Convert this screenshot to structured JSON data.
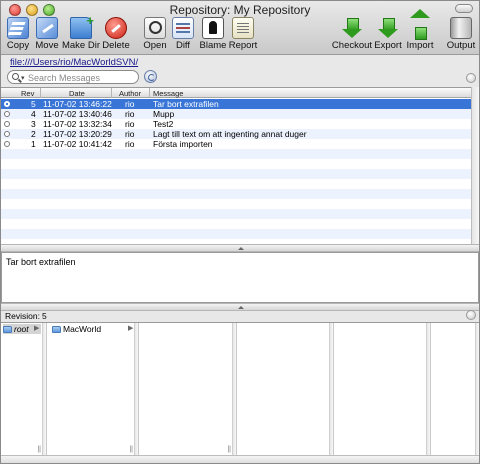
{
  "window": {
    "title": "Repository: My Repository"
  },
  "toolbar": {
    "buttons": [
      {
        "label": "Copy",
        "icon": "copy-icon"
      },
      {
        "label": "Move",
        "icon": "move-icon"
      },
      {
        "label": "Make Dir",
        "icon": "make-dir-icon"
      },
      {
        "label": "Delete",
        "icon": "delete-icon"
      },
      {
        "label": "Open",
        "icon": "open-icon"
      },
      {
        "label": "Diff",
        "icon": "diff-icon"
      },
      {
        "label": "Blame",
        "icon": "blame-icon"
      },
      {
        "label": "Report",
        "icon": "report-icon"
      },
      {
        "label": "Checkout",
        "icon": "checkout-icon"
      },
      {
        "label": "Export",
        "icon": "export-icon"
      },
      {
        "label": "Import",
        "icon": "import-icon"
      },
      {
        "label": "Output",
        "icon": "output-icon"
      }
    ]
  },
  "path": {
    "url": "file:///Users/rio/MacWorldSVN/"
  },
  "search": {
    "placeholder": "Search Messages"
  },
  "table": {
    "columns": [
      "Rev",
      "Date",
      "Author",
      "Message"
    ],
    "rows": [
      {
        "rev": "5",
        "date": "11-07-02 13:46:22",
        "author": "rio",
        "message": "Tar bort extrafilen",
        "selected": true
      },
      {
        "rev": "4",
        "date": "11-07-02 13:40:46",
        "author": "rio",
        "message": "Mupp",
        "selected": false
      },
      {
        "rev": "3",
        "date": "11-07-02 13:32:34",
        "author": "rio",
        "message": "Test2",
        "selected": false
      },
      {
        "rev": "2",
        "date": "11-07-02 13:20:29",
        "author": "rio",
        "message": "Lagt till text om att ingenting annat duger",
        "selected": false
      },
      {
        "rev": "1",
        "date": "11-07-02 10:41:42",
        "author": "rio",
        "message": "Första importen",
        "selected": false
      }
    ]
  },
  "message_text": "Tar bort extrafilen",
  "revision": {
    "label": "Revision:",
    "value": "5"
  },
  "browser": {
    "root_label": "root",
    "folder_label": "MacWorld"
  },
  "colors": {
    "selection": "#3875d7",
    "stripe": "#edf3fe"
  }
}
